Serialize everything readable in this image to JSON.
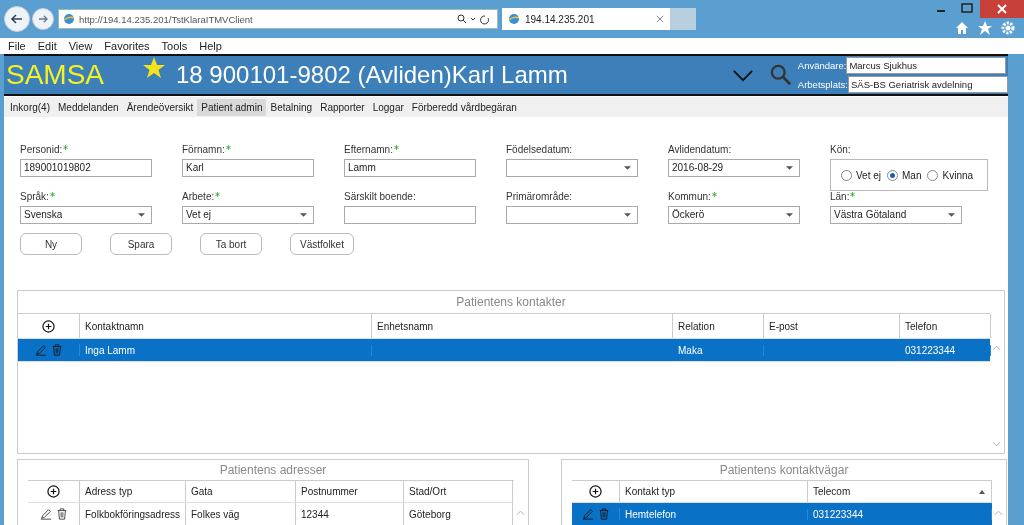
{
  "browser": {
    "address": "http://194.14.235.201/TstKlaraITMVClient",
    "tab_title": "194.14.235.201",
    "menu": [
      "File",
      "Edit",
      "View",
      "Favorites",
      "Tools",
      "Help"
    ]
  },
  "header": {
    "logo": "SAMSA",
    "title": "18 900101-9802 (Avliden)Karl Lamm",
    "user_label": "Användare:",
    "user": "Marcus Sjukhus",
    "workplace_label": "Arbetsplats:",
    "workplace": "SÄS-BS Geriatrisk avdelning"
  },
  "tabs": [
    {
      "label": "Inkorg(4)",
      "selected": false
    },
    {
      "label": "Meddelanden",
      "selected": false
    },
    {
      "label": "Ärendeöversikt",
      "selected": false
    },
    {
      "label": "Patient admin",
      "selected": true
    },
    {
      "label": "Betalning",
      "selected": false
    },
    {
      "label": "Rapporter",
      "selected": false
    },
    {
      "label": "Loggar",
      "selected": false
    },
    {
      "label": "Förberedd vårdbegäran",
      "selected": false
    }
  ],
  "form_rows": [
    [
      {
        "label": "Personid:",
        "required": true,
        "kind": "text",
        "value": "189001019802"
      },
      {
        "label": "Förnamn:",
        "required": true,
        "kind": "text",
        "value": "Karl"
      },
      {
        "label": "Efternamn:",
        "required": true,
        "kind": "text",
        "value": "Lamm"
      },
      {
        "label": "Födelsedatum:",
        "required": false,
        "kind": "select"
      },
      {
        "label": "Avlidendatum:",
        "required": false,
        "kind": "select",
        "value": "2016-08-29"
      }
    ],
    [
      {
        "label": "Språk:",
        "required": true,
        "kind": "select",
        "value": "Svenska"
      },
      {
        "label": "Arbete:",
        "required": true,
        "kind": "select",
        "value": "Vet ej"
      },
      {
        "label": "Särskilt boende:",
        "required": false,
        "kind": "text"
      },
      {
        "label": "Primärområde:",
        "required": false,
        "kind": "select"
      },
      {
        "label": "Kommun:",
        "required": true,
        "kind": "select",
        "value": "Öckerö"
      },
      {
        "label": "Län:",
        "required": true,
        "kind": "select",
        "value": "Västra Götaland"
      }
    ]
  ],
  "gender": {
    "label": "Kön:",
    "options": [
      {
        "label": "Vet ej",
        "selected": false
      },
      {
        "label": "Man",
        "selected": true
      },
      {
        "label": "Kvinna",
        "selected": false
      }
    ]
  },
  "buttons": [
    "Ny",
    "Spara",
    "Ta bort",
    "Västfolket"
  ],
  "tables": [
    {
      "title": "Patientens kontakter",
      "columns": [
        {
          "label": "Kontaktnamn"
        },
        {
          "label": "Enhetsnamn"
        },
        {
          "label": "Relation"
        },
        {
          "label": "E-post"
        },
        {
          "label": "Telefon"
        }
      ],
      "rows": [
        {
          "selected": true,
          "cells": [
            "Inga Lamm",
            "",
            "Maka",
            "",
            "031223344"
          ]
        }
      ]
    },
    {
      "title": "Patientens adresser",
      "columns": [
        {
          "label": "Adress typ"
        },
        {
          "label": "Gata"
        },
        {
          "label": "Postnummer"
        },
        {
          "label": "Stad/Ort"
        }
      ],
      "rows": [
        {
          "selected": false,
          "cells": [
            "Folkbokföringsadress",
            "Folkes väg",
            "12344",
            "Göteborg"
          ]
        }
      ]
    },
    {
      "title": "Patientens kontaktvägar",
      "columns": [
        {
          "label": "Kontakt typ"
        },
        {
          "label": "Telecom",
          "sorted": true
        }
      ],
      "rows": [
        {
          "selected": true,
          "cells": [
            "Hemtelefon",
            "031223344"
          ]
        }
      ]
    }
  ]
}
